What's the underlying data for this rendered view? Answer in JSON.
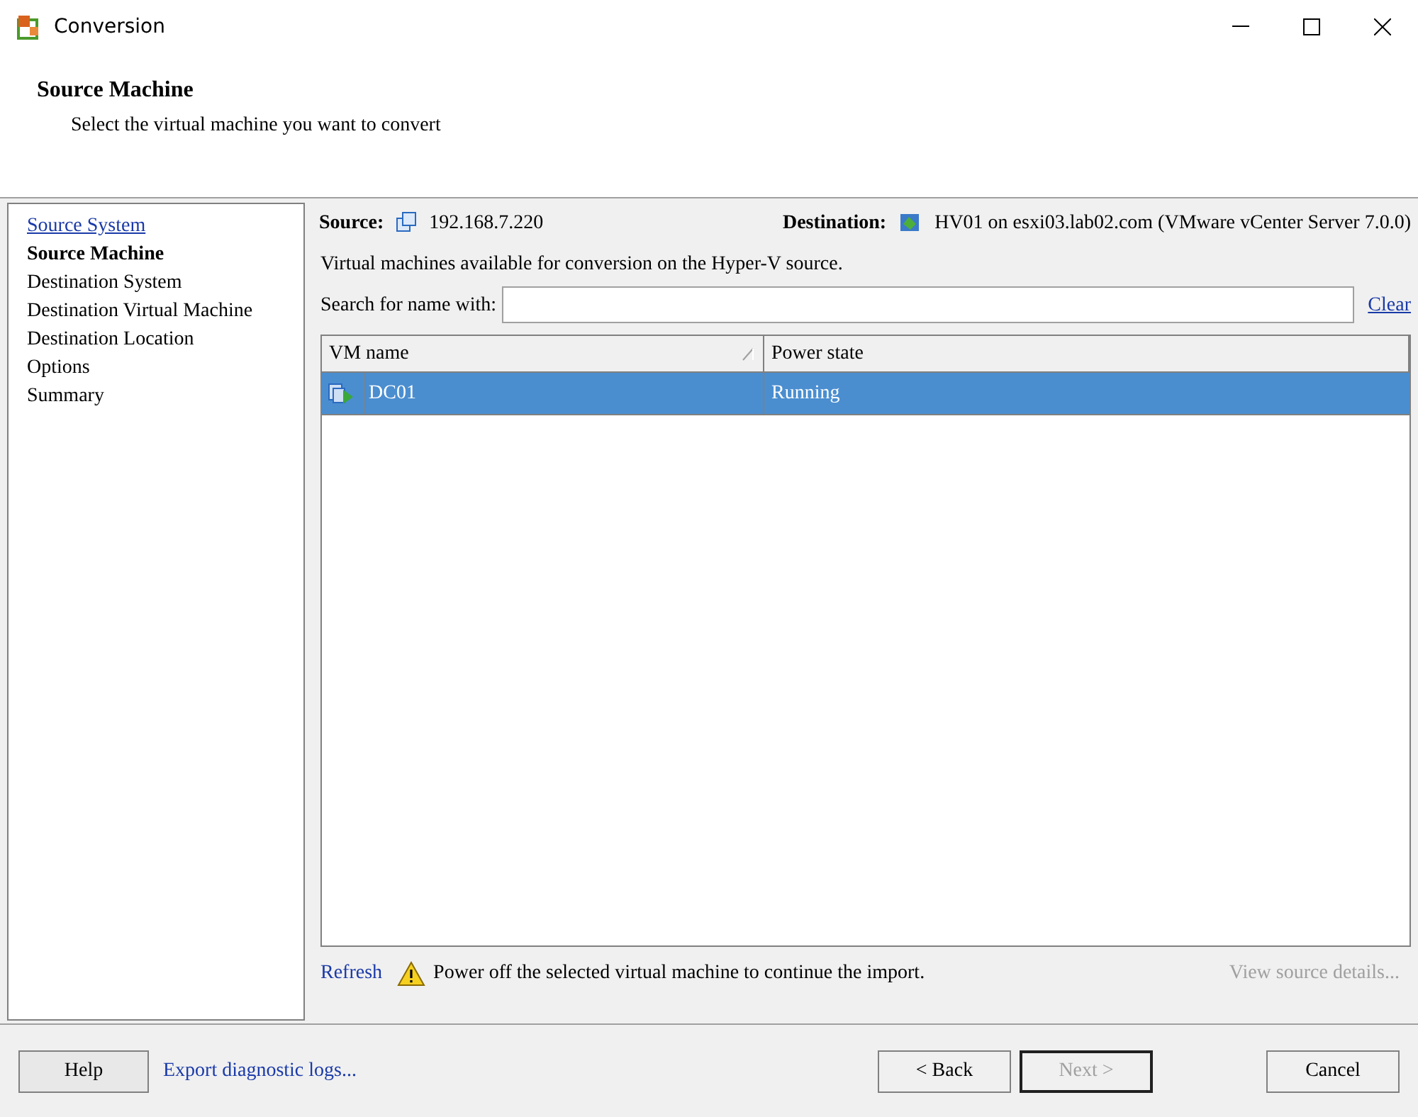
{
  "window": {
    "title": "Conversion"
  },
  "header": {
    "title": "Source Machine",
    "subtitle": "Select the virtual machine you want to convert"
  },
  "steps": [
    {
      "label": "Source System",
      "kind": "done"
    },
    {
      "label": "Source Machine",
      "kind": "current"
    },
    {
      "label": "Destination System",
      "kind": "pending"
    },
    {
      "label": "Destination Virtual Machine",
      "kind": "pending"
    },
    {
      "label": "Destination Location",
      "kind": "pending"
    },
    {
      "label": "Options",
      "kind": "pending"
    },
    {
      "label": "Summary",
      "kind": "pending"
    }
  ],
  "source": {
    "label": "Source:",
    "value": "192.168.7.220"
  },
  "destination": {
    "label": "Destination:",
    "value": "HV01 on esxi03.lab02.com (VMware vCenter Server 7.0.0)"
  },
  "description": "Virtual machines available for conversion on the Hyper-V source.",
  "search": {
    "label": "Search for name with:",
    "clear": "Clear"
  },
  "table": {
    "columns": [
      {
        "label": "VM name",
        "sorted": true
      },
      {
        "label": "Power state",
        "sorted": false
      }
    ],
    "rows": [
      {
        "name": "DC01",
        "power_state": "Running",
        "selected": true
      }
    ]
  },
  "refresh": "Refresh",
  "warning": "Power off the selected virtual machine to continue the import.",
  "details_link": {
    "label": "View source details...",
    "disabled": true
  },
  "footer": {
    "help": "Help",
    "export": "Export diagnostic logs...",
    "buttons": [
      {
        "label": "< Back",
        "disabled": false,
        "default": false
      },
      {
        "label": "Next >",
        "disabled": true,
        "default": true
      },
      {
        "label": "Cancel",
        "disabled": false,
        "default": false
      }
    ]
  }
}
